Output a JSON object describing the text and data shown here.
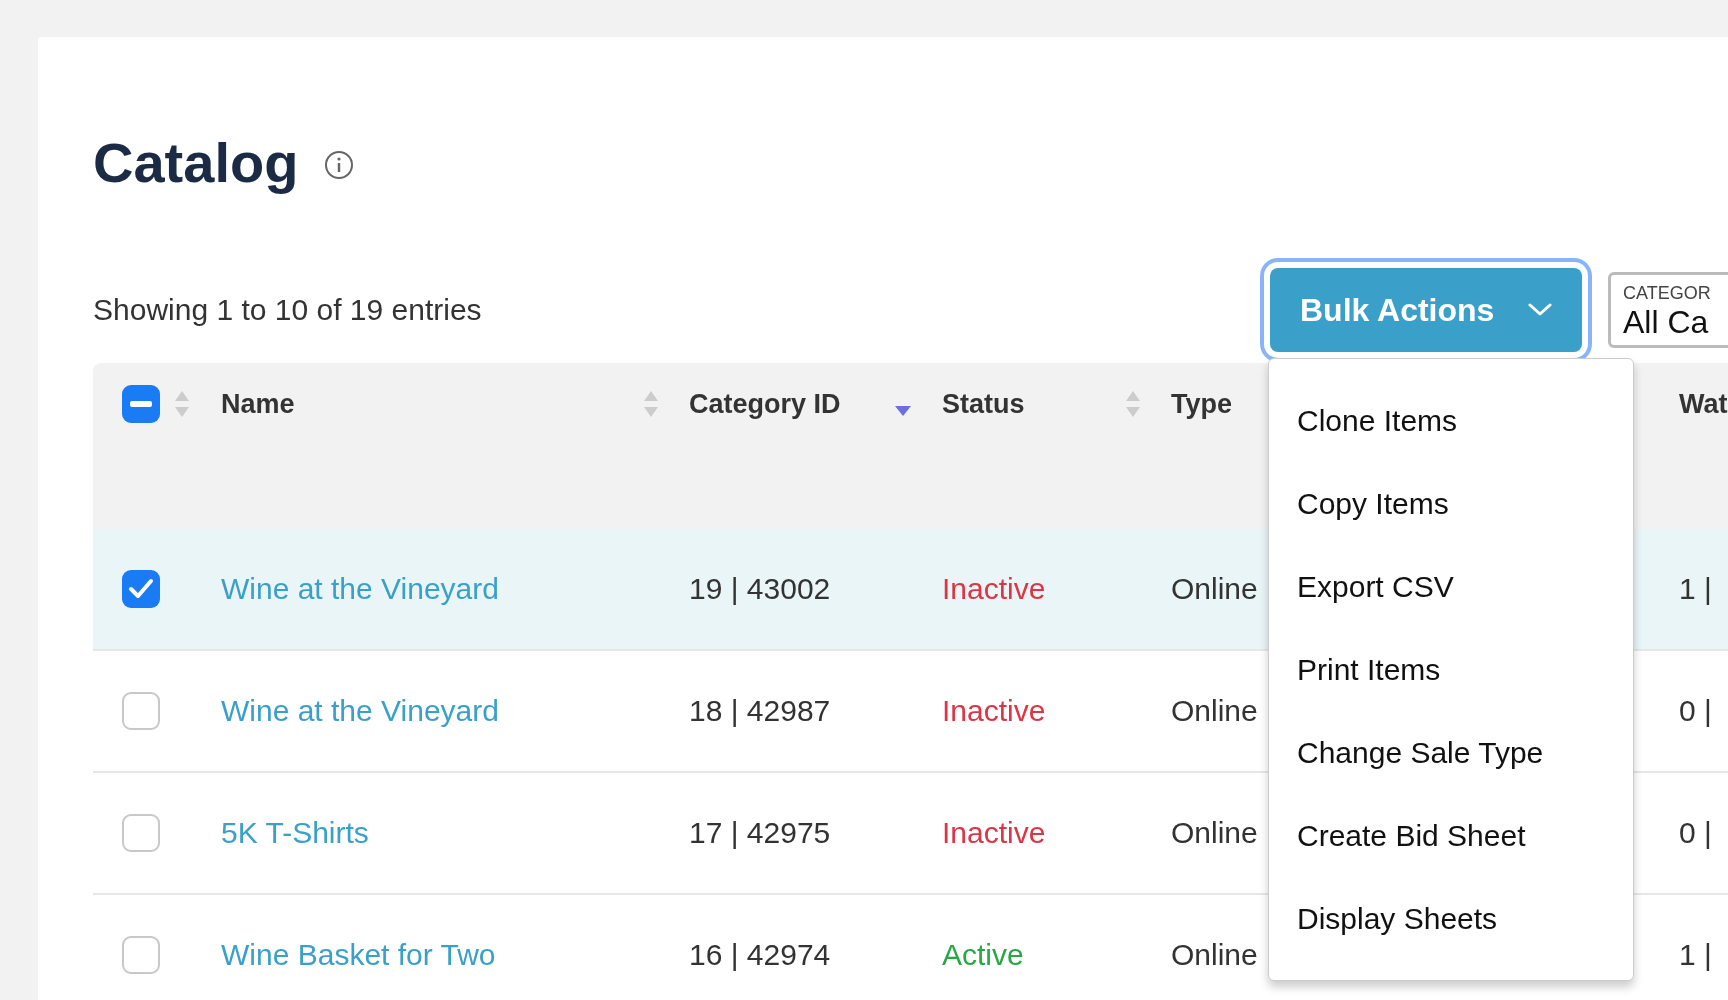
{
  "title": "Catalog",
  "summary": "Showing 1 to 10 of 19 entries",
  "bulk_actions": {
    "label": "Bulk Actions",
    "expanded": true
  },
  "category_filter": {
    "label": "CATEGOR",
    "value": "All Ca"
  },
  "menu": [
    "Clone Items",
    "Copy Items",
    "Export CSV",
    "Print Items",
    "Change Sale Type",
    "Create Bid Sheet",
    "Display Sheets"
  ],
  "header_checkbox": {
    "indeterminate": true
  },
  "columns": [
    {
      "label": "Name",
      "sorted": false
    },
    {
      "label": "Category ID",
      "sorted": true
    },
    {
      "label": "Status",
      "sorted": false
    },
    {
      "label": "Type"
    },
    {
      "label": "Wat"
    }
  ],
  "rows": [
    {
      "checked": true,
      "name": "Wine at the Vineyard",
      "category_id": "19 | 43002",
      "status": "Inactive",
      "color": "#dc3545",
      "type": "Online",
      "column_6": "1 |"
    },
    {
      "checked": false,
      "name": "Wine at the Vineyard",
      "category_id": "18 | 42987",
      "status": "Inactive",
      "color": "#dc3545",
      "type": "Online",
      "column_6": "0 |"
    },
    {
      "checked": false,
      "name": "5K T-Shirts",
      "category_id": "17 | 42975",
      "status": "Inactive",
      "color": "#dc3545",
      "type": "Online",
      "column_6": "0 |"
    },
    {
      "checked": false,
      "name": "Wine Basket for Two",
      "category_id": "16 | 42974",
      "status": "Active",
      "color": "#28a745",
      "type": "Online",
      "column_6": "1 |"
    }
  ]
}
